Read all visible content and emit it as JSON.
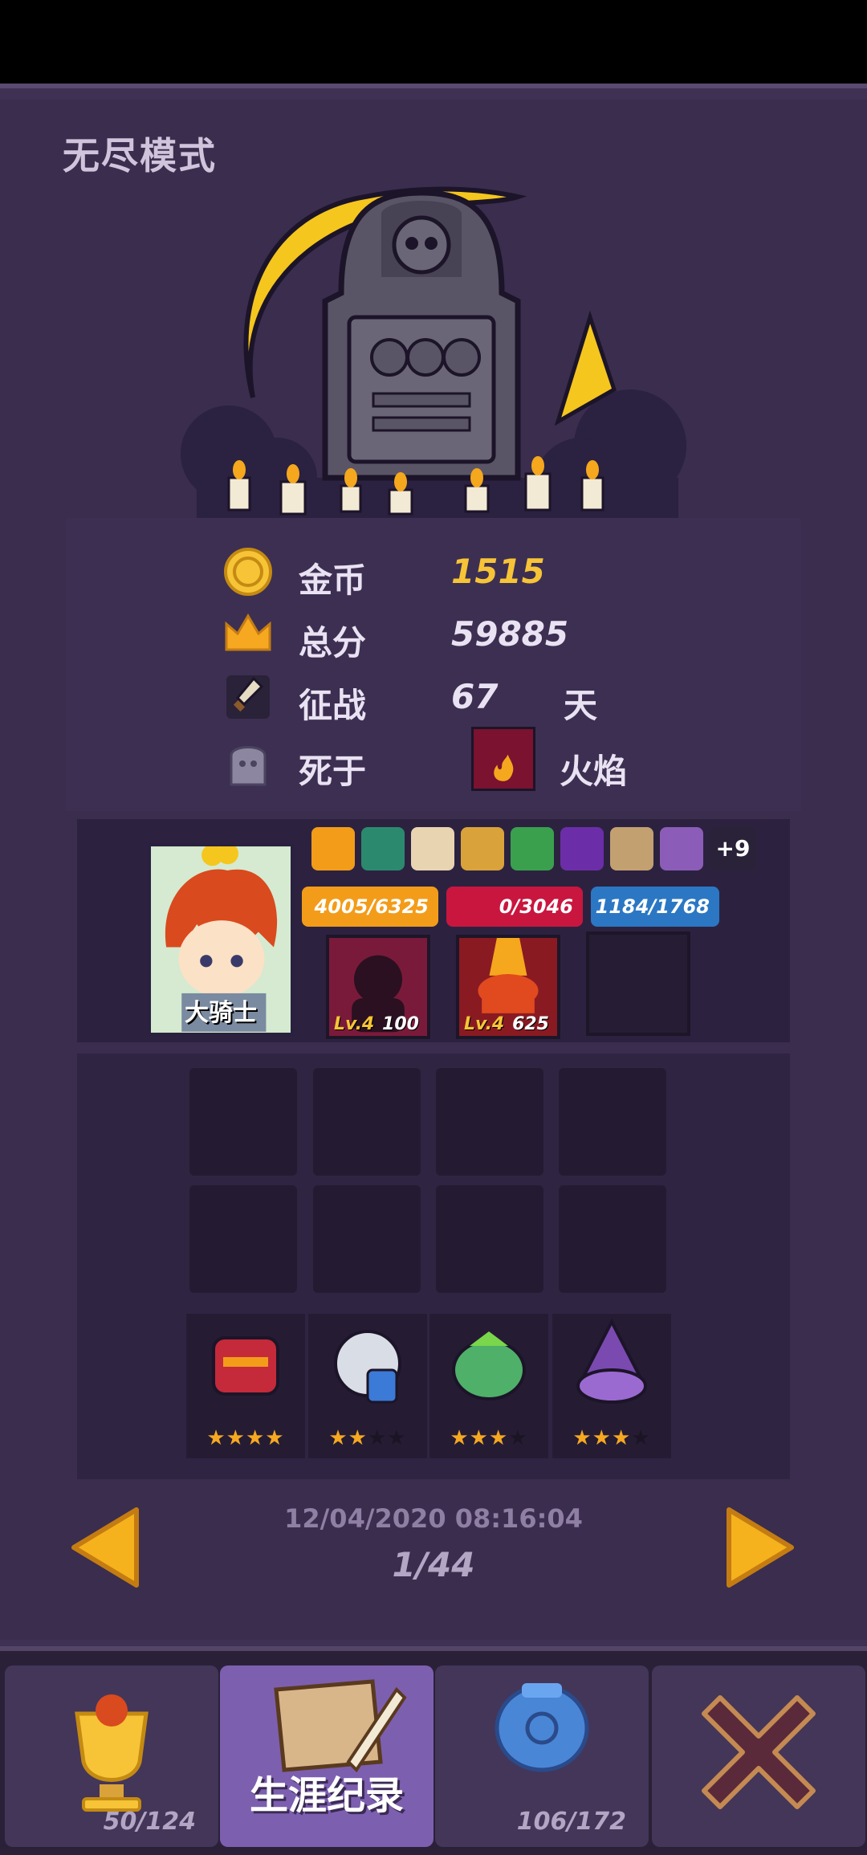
{
  "mode_title": "无尽模式",
  "stats": {
    "gold": {
      "label": "金币",
      "value": "1515"
    },
    "score": {
      "label": "总分",
      "value": "59885"
    },
    "campaign": {
      "label": "征战",
      "value": "67",
      "unit": "天"
    },
    "death": {
      "label": "死于",
      "cause": "火焰"
    }
  },
  "hero": {
    "name": "大骑士",
    "buffs": [
      "flower-icon",
      "slime-icon",
      "scroll-icon",
      "shield-icon",
      "plant-icon",
      "vip-icon",
      "sign-icon",
      "axe-icon"
    ],
    "more_buffs": "+9",
    "armor": "4005/6325",
    "health": "0/3046",
    "energy": "1184/1768",
    "skills": [
      {
        "level": "Lv.4",
        "value": "100"
      },
      {
        "level": "Lv.4",
        "value": "625"
      }
    ]
  },
  "pets": [
    {
      "name": "red-knight-pet",
      "stars": 4,
      "max": 4
    },
    {
      "name": "armored-knight-pet",
      "stars": 2,
      "max": 4
    },
    {
      "name": "green-owl-pet",
      "stars": 3,
      "max": 4
    },
    {
      "name": "witch-pet",
      "stars": 3,
      "max": 4
    }
  ],
  "record": {
    "timestamp": "12/04/2020 08:16:04",
    "page": "1/44"
  },
  "tabs": [
    {
      "name": "trophy",
      "count": "50/124"
    },
    {
      "name": "career",
      "label": "生涯纪录"
    },
    {
      "name": "pot",
      "count": "106/172"
    },
    {
      "name": "close"
    }
  ],
  "colors": {
    "gold": "#f6c436",
    "panel": "#3f3154",
    "active_tab": "#7d5fb0"
  }
}
